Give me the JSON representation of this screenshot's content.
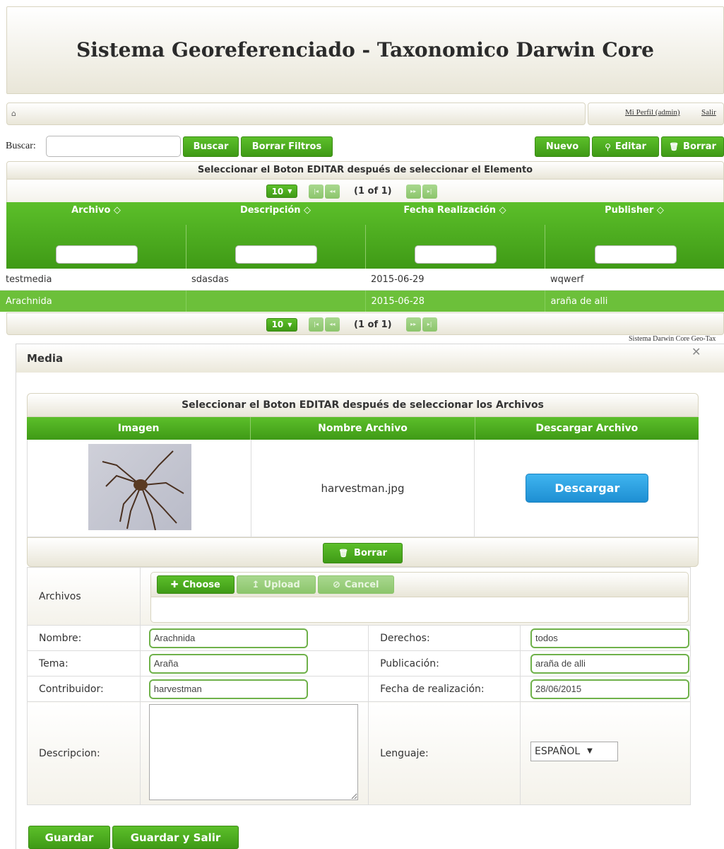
{
  "header": {
    "title": "Sistema Georeferenciado - Taxonomico Darwin Core"
  },
  "nav": {
    "home_icon": "home-icon",
    "profile_link": "Mi Perfil (admin)",
    "logout_link": "Salir"
  },
  "toolbar": {
    "search_label": "Buscar:",
    "search_value": "",
    "search_button": "Buscar",
    "clear_button": "Borrar Filtros",
    "new_button": "Nuevo",
    "edit_button": "Editar",
    "delete_button": "Borrar"
  },
  "grid": {
    "caption": "Seleccionar el Boton EDITAR después de seleccionar el Elemento",
    "rows_per_page": "10",
    "page_info": "(1 of 1)",
    "columns": [
      "Archivo ◇",
      "Descripción ◇",
      "Fecha Realización ◇",
      "Publisher ◇"
    ],
    "rows": [
      [
        "testmedia",
        "sdasdas",
        "2015-06-29",
        "wqwerf"
      ],
      [
        "Arachnida",
        "",
        "2015-06-28",
        "araña de alli"
      ]
    ],
    "selected_row": 1
  },
  "footer_text": "Sistema Darwin Core Geo-Tax",
  "dialog": {
    "title": "Media",
    "close_icon": "close-icon",
    "files_caption": "Seleccionar el Boton EDITAR después de seleccionar los Archivos",
    "files_columns": [
      "Imagen",
      "Nombre Archivo",
      "Descargar Archivo"
    ],
    "file_name": "harvestman.jpg",
    "download_button": "Descargar",
    "delete_button": "Borrar",
    "upload": {
      "label": "Archivos",
      "choose": "Choose",
      "upload": "Upload",
      "cancel": "Cancel"
    },
    "form": {
      "nombre_label": "Nombre:",
      "nombre_value": "Arachnida",
      "derechos_label": "Derechos:",
      "derechos_value": "todos",
      "tema_label": "Tema:",
      "tema_value": "Araña",
      "publicacion_label": "Publicación:",
      "publicacion_value": "araña de alli",
      "contribuidor_label": "Contribuidor:",
      "contribuidor_value": "harvestman",
      "fecha_label": "Fecha de realización:",
      "fecha_value": "28/06/2015",
      "descripcion_label": "Descripcion:",
      "descripcion_value": "",
      "lenguaje_label": "Lenguaje:",
      "lenguaje_value": "ESPAÑOL"
    },
    "save_button": "Guardar",
    "save_exit_button": "Guardar y Salir"
  }
}
